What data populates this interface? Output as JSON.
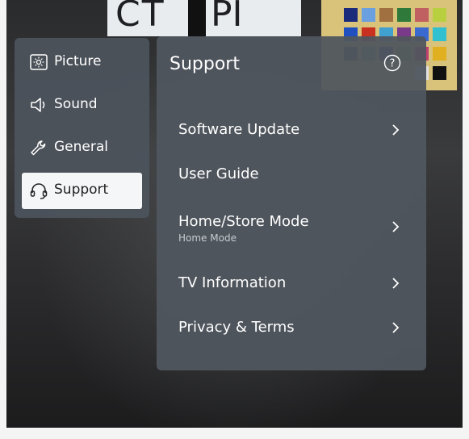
{
  "background": {
    "sign_text_left": "CT",
    "sign_text_right": "PI"
  },
  "sidebar": {
    "items": [
      {
        "label": "Picture",
        "icon": "picture-icon"
      },
      {
        "label": "Sound",
        "icon": "speaker-icon"
      },
      {
        "label": "General",
        "icon": "wrench-icon"
      },
      {
        "label": "Support",
        "icon": "headset-icon",
        "active": true
      }
    ]
  },
  "main": {
    "title": "Support",
    "help_icon": "question-mark-icon",
    "items": [
      {
        "label": "Software Update",
        "sublabel": "",
        "chevron": true
      },
      {
        "label": "User Guide",
        "sublabel": "",
        "chevron": false
      },
      {
        "label": "Home/Store Mode",
        "sublabel": "Home Mode",
        "chevron": true
      },
      {
        "label": "TV Information",
        "sublabel": "",
        "chevron": true
      },
      {
        "label": "Privacy & Terms",
        "sublabel": "",
        "chevron": true
      }
    ]
  },
  "colors": {
    "panel": "#50565e",
    "active_item_bg": "#f5f6f7",
    "text": "#ffffff"
  }
}
